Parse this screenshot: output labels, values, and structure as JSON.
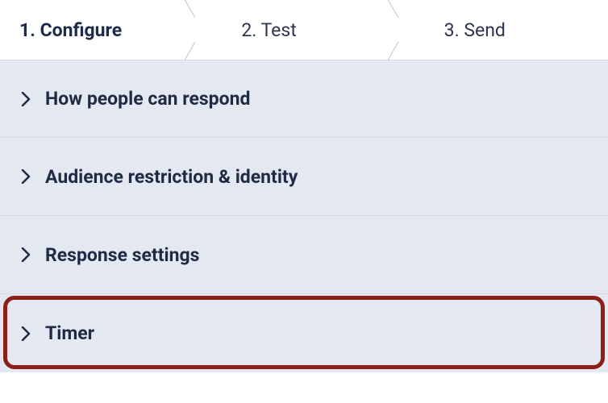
{
  "wizard": {
    "steps": [
      {
        "label": "1. Configure",
        "active": true
      },
      {
        "label": "2. Test",
        "active": false
      },
      {
        "label": "3. Send",
        "active": false
      }
    ]
  },
  "panels": [
    {
      "title": "How people can respond",
      "highlight": false
    },
    {
      "title": "Audience restriction & identity",
      "highlight": false
    },
    {
      "title": "Response settings",
      "highlight": false
    },
    {
      "title": "Timer",
      "highlight": true
    }
  ]
}
